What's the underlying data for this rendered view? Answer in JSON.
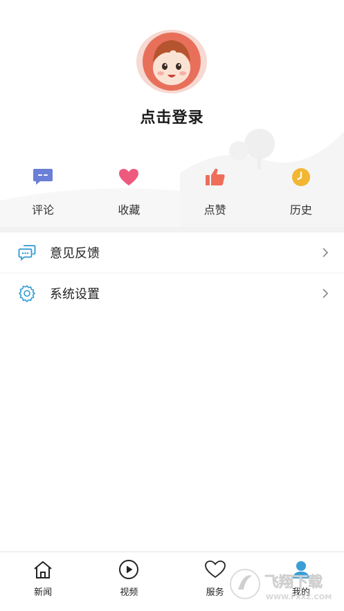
{
  "profile": {
    "login_label": "点击登录"
  },
  "quick_actions": [
    {
      "label": "评论",
      "icon": "comment-icon",
      "color": "#6b7fd7"
    },
    {
      "label": "收藏",
      "icon": "heart-icon",
      "color": "#ee5a7e"
    },
    {
      "label": "点赞",
      "icon": "thumbs-up-icon",
      "color": "#ee6e5a"
    },
    {
      "label": "历史",
      "icon": "clock-icon",
      "color": "#f2b632"
    }
  ],
  "menu": [
    {
      "label": "意见反馈",
      "icon": "feedback-icon"
    },
    {
      "label": "系统设置",
      "icon": "gear-icon"
    }
  ],
  "tabbar": [
    {
      "label": "新闻",
      "icon": "home-icon"
    },
    {
      "label": "视频",
      "icon": "play-icon"
    },
    {
      "label": "服务",
      "icon": "heart-outline-icon"
    },
    {
      "label": "我的",
      "icon": "user-icon"
    }
  ],
  "colors": {
    "accent": "#3a9fd6",
    "icon_blue": "#2d9bd3"
  },
  "watermark": {
    "text": "飞翔下载",
    "url": "WWW.FXXZ.COM"
  }
}
